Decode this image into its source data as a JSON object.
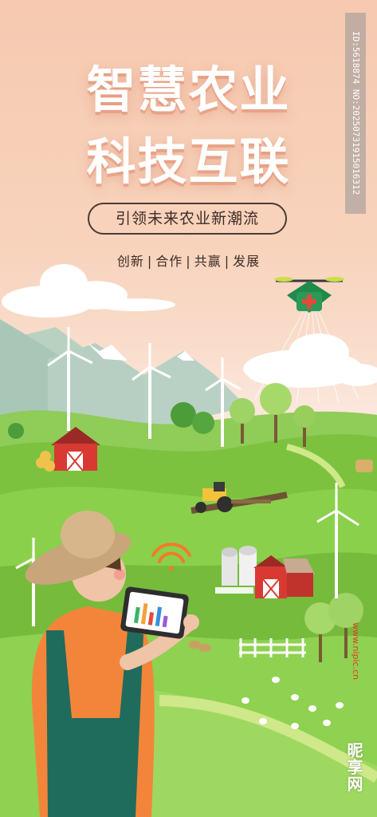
{
  "poster": {
    "title_line1": "智慧农业",
    "title_line2": "科技互联",
    "slogan": "引领未来农业新潮流",
    "keywords": [
      "创新",
      "合作",
      "共赢",
      "发展"
    ],
    "separator": "|",
    "colors": {
      "background": "#f7cdb5",
      "grass": "#7cc23f",
      "barn": "#d83a33",
      "title": "#ffffff"
    }
  },
  "watermark": {
    "id_text": "ID:5618874 NO:20250731915016312",
    "url": "www.nipic.cn",
    "logo": "昵享网"
  },
  "icons": [
    "drone-icon",
    "wifi-icon",
    "tablet-chart-icon",
    "windmill-icon",
    "tractor-icon",
    "barn-icon",
    "silo-icon"
  ]
}
